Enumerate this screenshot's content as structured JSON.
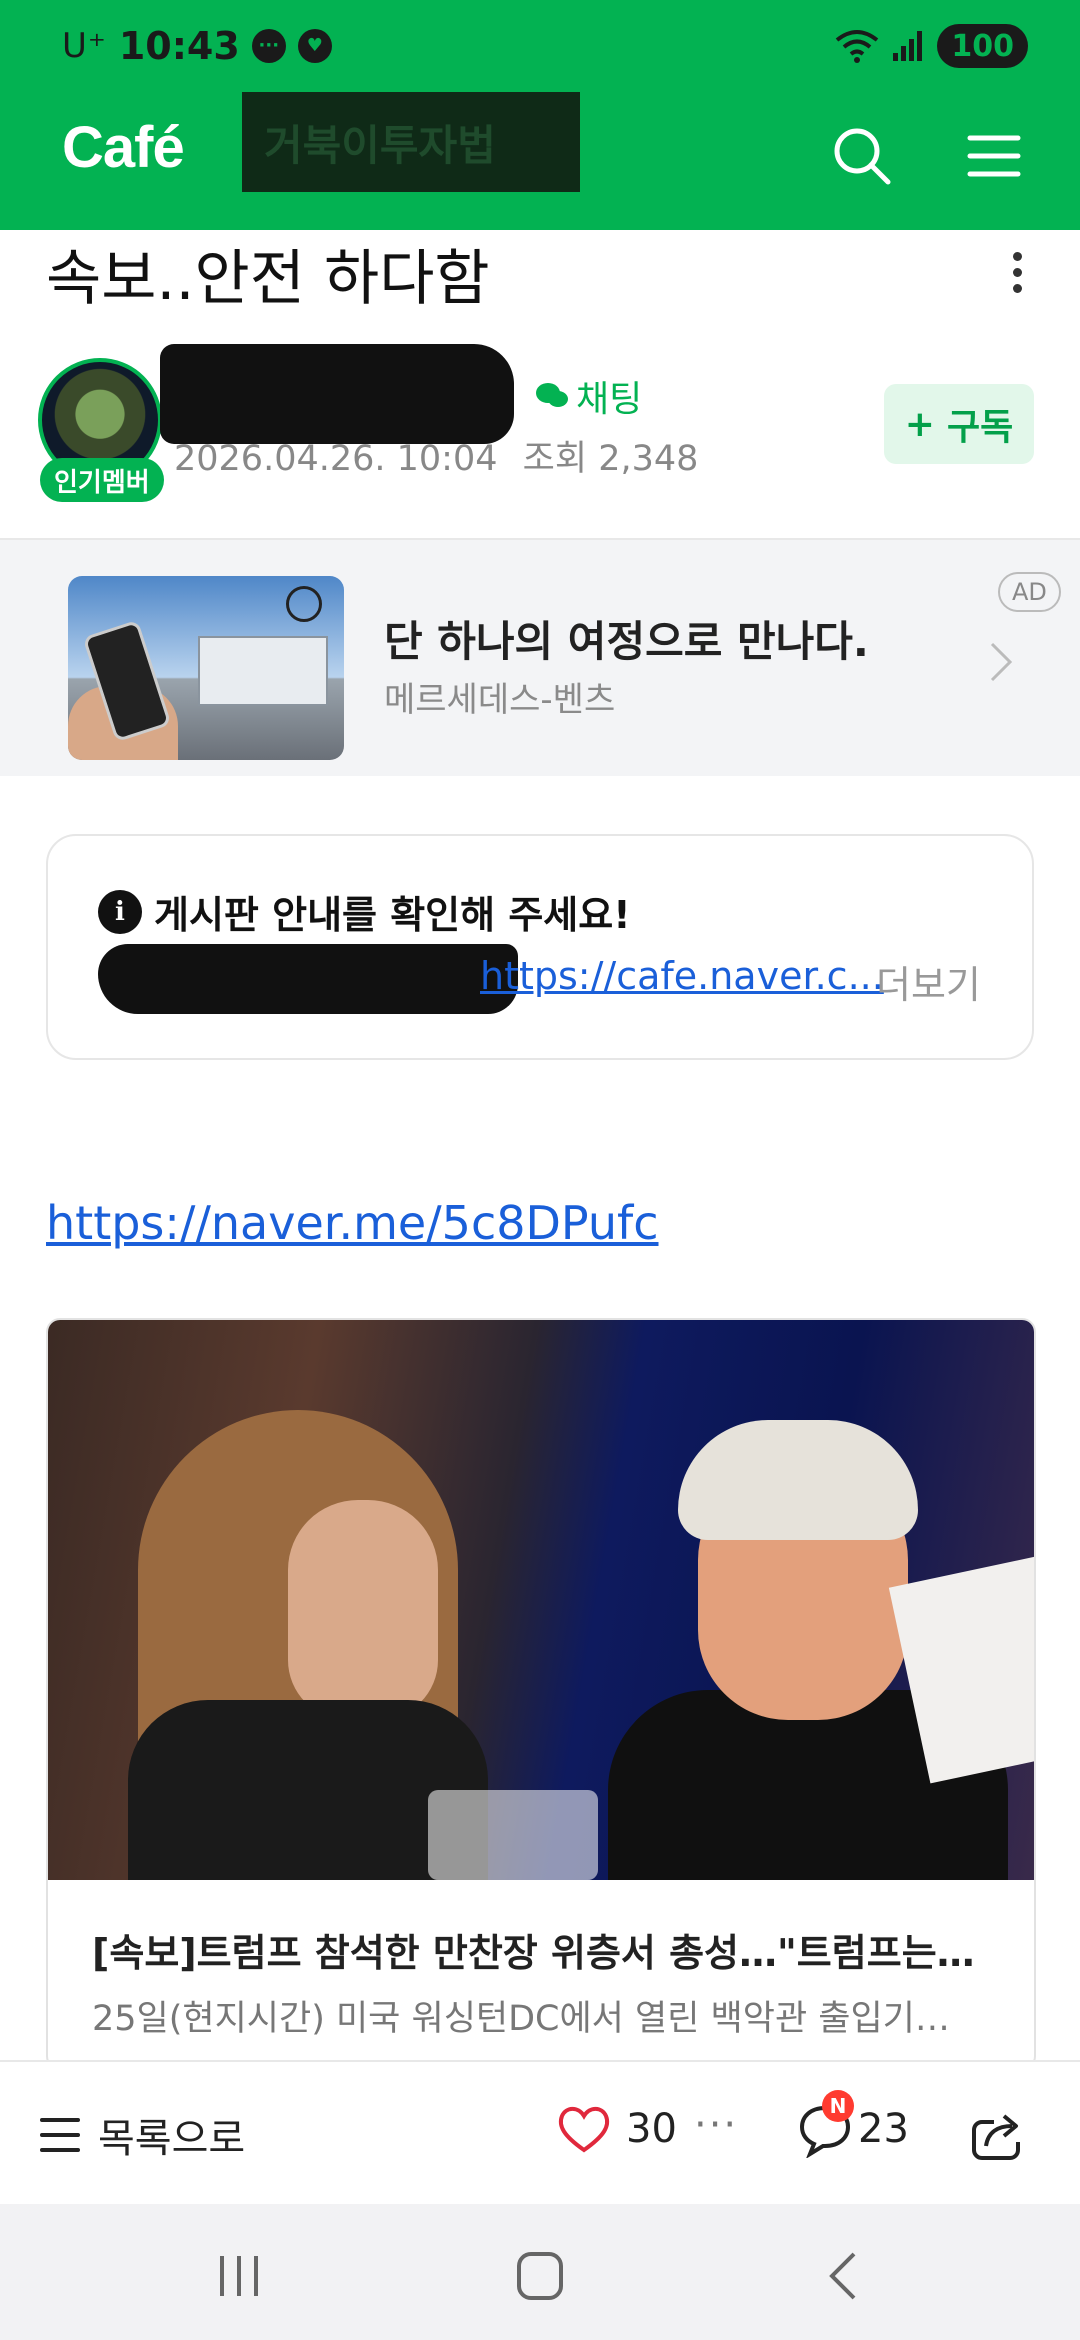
{
  "status_bar": {
    "carrier": "U⁺",
    "time": "10:43",
    "battery": "100"
  },
  "app_bar": {
    "logo": "Café",
    "cafe_name": "거북이투자법"
  },
  "article": {
    "title": "속보..안전 하다함",
    "chat_label": "채팅",
    "date": "2026.04.26. 10:04",
    "views_label": "조회",
    "views": "2,348",
    "member_badge": "인기멤버",
    "subscribe_label": "구독"
  },
  "ad": {
    "title": "단 하나의 여정으로 만나다.",
    "advertiser": "메르세데스-벤츠",
    "tag": "AD"
  },
  "notice": {
    "heading": "게시판 안내를 확인해 주세요!",
    "link": "https://cafe.naver.c...",
    "more_label": "더보기"
  },
  "body": {
    "link": "https://naver.me/5c8DPufc"
  },
  "news_card": {
    "title": "[속보]트럼프 참석한 만찬장 위층서 총성…\"트럼프는…",
    "description": "25일(현지시간) 미국 워싱턴DC에서 열린 백악관 출입기…"
  },
  "bottom_bar": {
    "list_label": "목록으로",
    "likes": "30",
    "more": "···",
    "comments": "23",
    "new_badge": "N"
  },
  "colors": {
    "brand_green": "#03b252",
    "link_blue": "#1a5fd9"
  },
  "icons": [
    "search-icon",
    "menu-icon",
    "more-vertical-icon",
    "chat-icon",
    "plus-icon",
    "chevron-right-icon",
    "info-icon",
    "hamburger-icon",
    "heart-icon",
    "comment-icon",
    "share-icon",
    "recent-apps-icon",
    "home-icon",
    "back-icon"
  ]
}
